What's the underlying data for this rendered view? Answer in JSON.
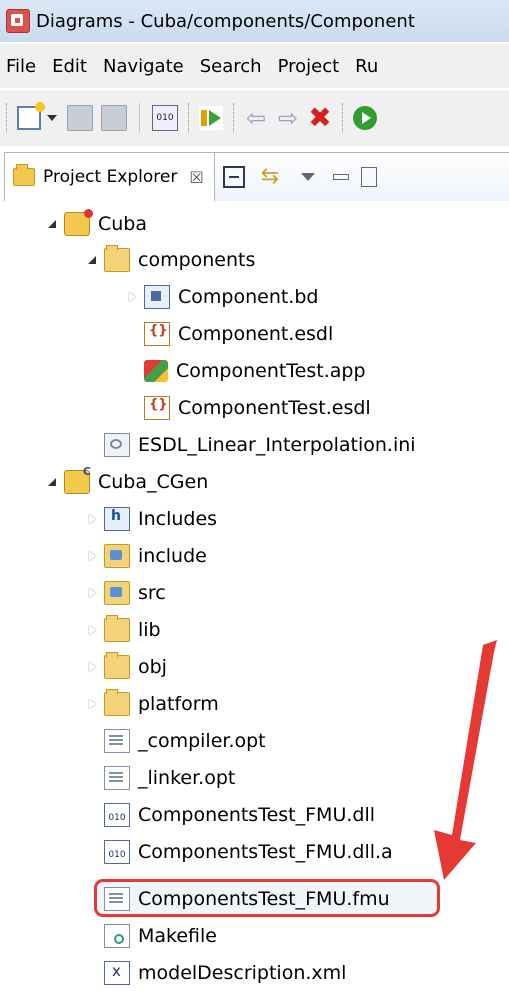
{
  "window": {
    "title": "Diagrams - Cuba/components/Component"
  },
  "menu": [
    "File",
    "Edit",
    "Navigate",
    "Search",
    "Project",
    "Ru"
  ],
  "toolbar": {
    "icons": [
      "new-icon",
      "save-icon",
      "save-all-icon",
      "binary-icon",
      "run-icon",
      "undo-icon",
      "redo-icon",
      "stop-icon",
      "go-icon"
    ]
  },
  "panel": {
    "tab_label": "Project Explorer",
    "close_glyph": "☒"
  },
  "tree": [
    {
      "label": "Cuba",
      "icon": "project-icon",
      "twisty": "open"
    },
    {
      "label": "components",
      "icon": "folder-icon",
      "twisty": "open"
    },
    {
      "label": "Component.bd",
      "icon": "block-diagram-icon",
      "twisty": "closed"
    },
    {
      "label": "Component.esdl",
      "icon": "esdl-file-icon",
      "twisty": "none"
    },
    {
      "label": "ComponentTest.app",
      "icon": "app-file-icon",
      "twisty": "none"
    },
    {
      "label": "ComponentTest.esdl",
      "icon": "esdl-file-icon",
      "twisty": "none"
    },
    {
      "label": "ESDL_Linear_Interpolation.ini",
      "icon": "ini-file-icon",
      "twisty": "none"
    },
    {
      "label": "Cuba_CGen",
      "icon": "c-project-icon",
      "twisty": "open"
    },
    {
      "label": "Includes",
      "icon": "includes-icon",
      "twisty": "closed"
    },
    {
      "label": "include",
      "icon": "source-folder-icon",
      "twisty": "closed"
    },
    {
      "label": "src",
      "icon": "source-folder-icon",
      "twisty": "closed"
    },
    {
      "label": "lib",
      "icon": "folder-icon",
      "twisty": "closed"
    },
    {
      "label": "obj",
      "icon": "folder-icon",
      "twisty": "closed"
    },
    {
      "label": "platform",
      "icon": "folder-icon",
      "twisty": "closed"
    },
    {
      "label": "_compiler.opt",
      "icon": "text-file-icon",
      "twisty": "none"
    },
    {
      "label": "_linker.opt",
      "icon": "text-file-icon",
      "twisty": "none"
    },
    {
      "label": "ComponentsTest_FMU.dll",
      "icon": "binary-file-icon",
      "twisty": "none"
    },
    {
      "label": "ComponentsTest_FMU.dll.a",
      "icon": "binary-file-icon",
      "twisty": "none"
    },
    {
      "label": "ComponentsTest_FMU.fmu",
      "icon": "text-file-icon",
      "twisty": "none"
    },
    {
      "label": "Makefile",
      "icon": "makefile-icon",
      "twisty": "none"
    },
    {
      "label": "modelDescription.xml",
      "icon": "xml-file-icon",
      "twisty": "none"
    }
  ],
  "colors": {
    "highlight": "#e53935",
    "arrow": "#e53935"
  }
}
